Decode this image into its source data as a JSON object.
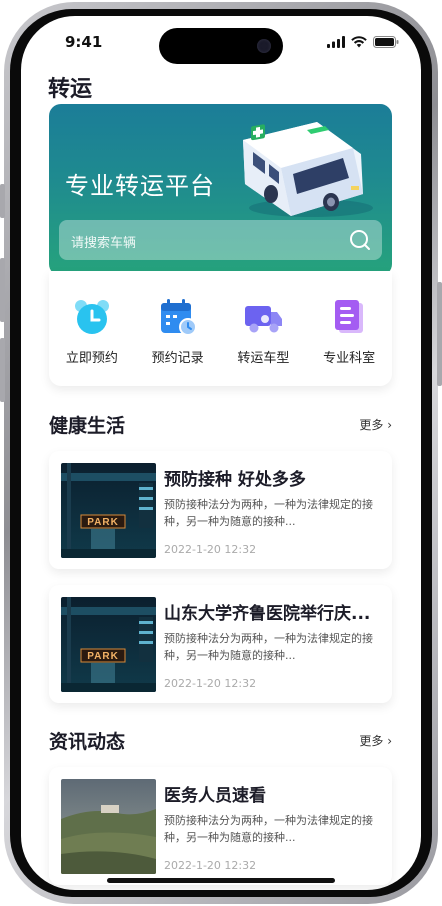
{
  "status_bar": {
    "time": "9:41"
  },
  "page": {
    "title": "转运"
  },
  "hero": {
    "title": "专业转运平台",
    "search_placeholder": "请搜索车辆",
    "bg_color_top": "#1b7d98",
    "bg_color_bottom": "#26a37c"
  },
  "quick_menu": [
    {
      "label": "立即预约",
      "icon": "alarm-clock-icon",
      "color": "#29c3ef"
    },
    {
      "label": "预约记录",
      "icon": "calendar-clock-icon",
      "color": "#2f8cf0"
    },
    {
      "label": "转运车型",
      "icon": "truck-icon",
      "color": "#6c63f0"
    },
    {
      "label": "专业科室",
      "icon": "document-icon",
      "color": "#a45cf2"
    }
  ],
  "health_section": {
    "title": "健康生活",
    "more": "更多",
    "items": [
      {
        "title": "预防接种 好处多多",
        "desc": "预防接种法分为两种，一种为法律规定的接种，另一种为随意的接种...",
        "date": "2022-1-20 12:32",
        "image": "parking-garage-night"
      },
      {
        "title": "山东大学齐鲁医院举行庆...",
        "desc": "预防接种法分为两种，一种为法律规定的接种，另一种为随意的接种...",
        "date": "2022-1-20 12:32",
        "image": "parking-garage-night"
      }
    ]
  },
  "news_section": {
    "title": "资讯动态",
    "more": "更多",
    "items": [
      {
        "title": "医务人员速看",
        "desc": "预防接种法分为两种，一种为法律规定的接种，另一种为随意的接种...",
        "date": "2022-1-20 12:32",
        "image": "grassy-hill-landscape"
      }
    ]
  },
  "image_text": {
    "park_sign": "PARK"
  }
}
